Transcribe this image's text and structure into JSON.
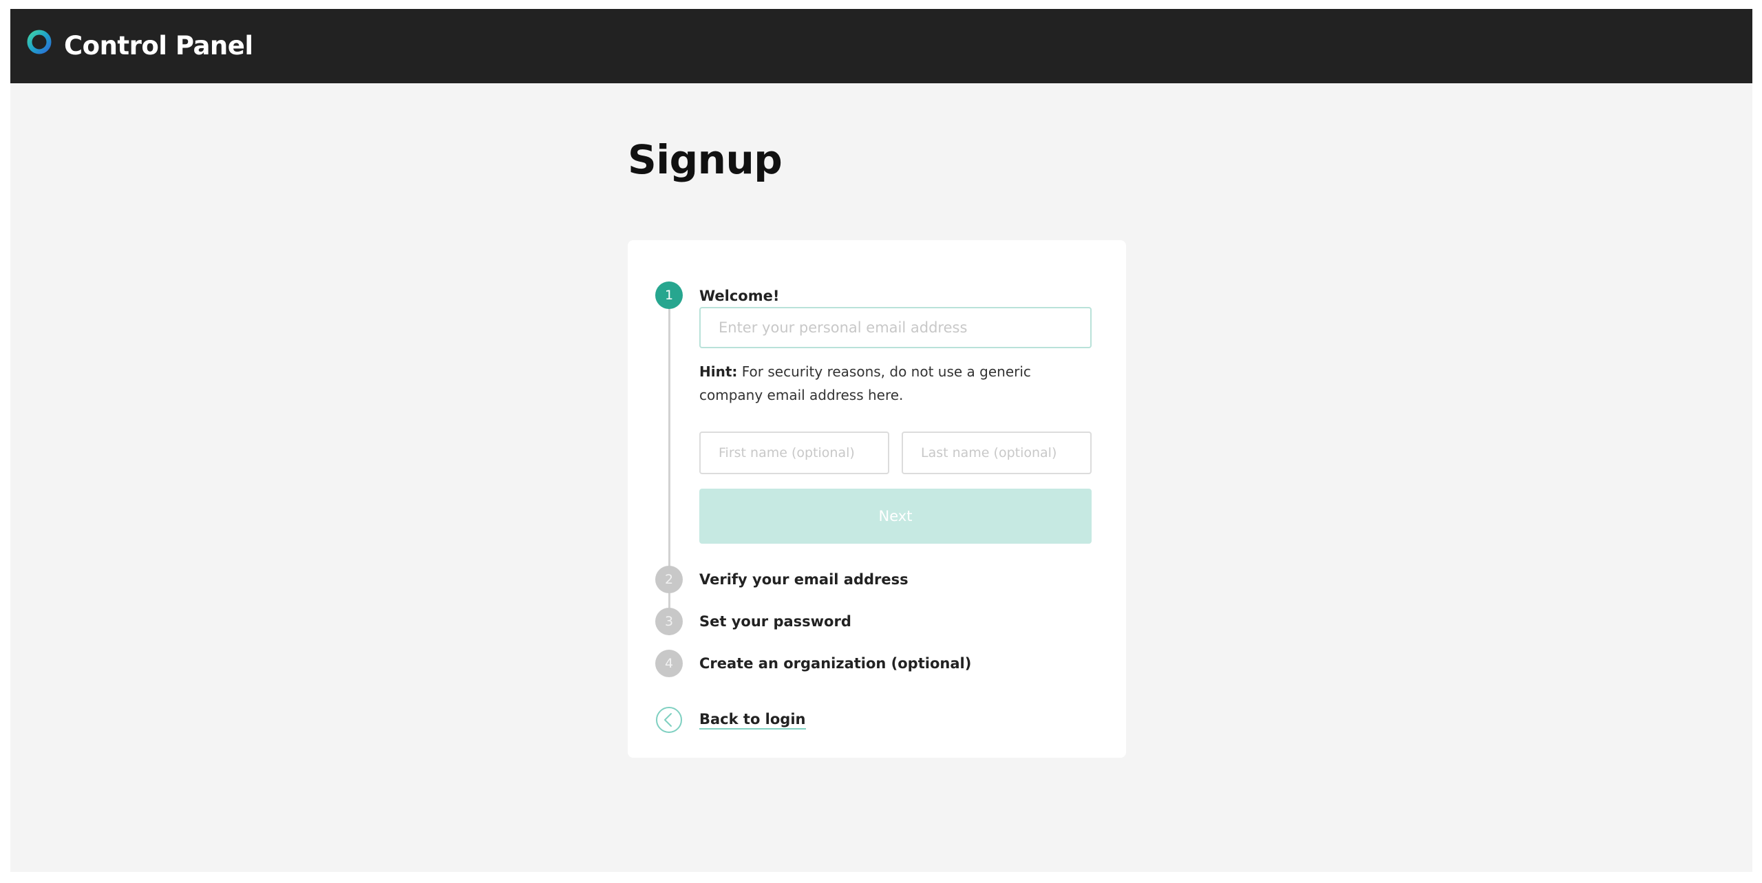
{
  "header": {
    "logo_icon": "ring-logo-icon",
    "app_title": "Control Panel"
  },
  "page": {
    "title": "Signup"
  },
  "steps": [
    {
      "number": "1",
      "label": "Welcome!",
      "state": "active"
    },
    {
      "number": "2",
      "label": "Verify your email address",
      "state": "inactive"
    },
    {
      "number": "3",
      "label": "Set your password",
      "state": "inactive"
    },
    {
      "number": "4",
      "label": "Create an organization (optional)",
      "state": "inactive"
    }
  ],
  "form": {
    "email_placeholder": "Enter your personal email address",
    "email_value": "",
    "hint_label": "Hint:",
    "hint_text": "For security reasons, do not use a generic company email address here.",
    "first_name_placeholder": "First name (optional)",
    "last_name_placeholder": "Last name (optional)",
    "next_label": "Next"
  },
  "back": {
    "icon": "chevron-left-circle-icon",
    "label": "Back to login"
  },
  "colors": {
    "header_bg": "#222222",
    "accent": "#27a68f",
    "button_disabled": "#c6e9e2",
    "page_bg": "#f4f4f4"
  }
}
